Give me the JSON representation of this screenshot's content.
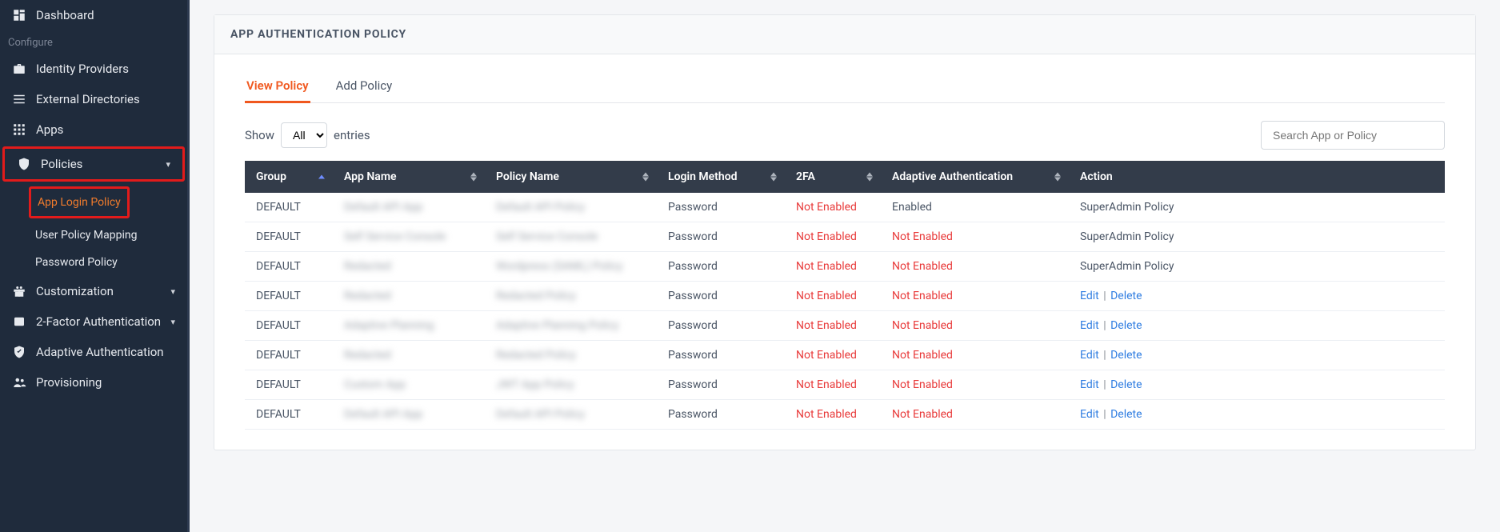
{
  "sidebar": {
    "dashboard": "Dashboard",
    "configure_label": "Configure",
    "identity_providers": "Identity Providers",
    "external_directories": "External Directories",
    "apps": "Apps",
    "policies": "Policies",
    "policies_children": {
      "app_login": "App Login Policy",
      "user_mapping": "User Policy Mapping",
      "password_policy": "Password Policy"
    },
    "customization": "Customization",
    "two_factor": "2-Factor Authentication",
    "adaptive_auth": "Adaptive Authentication",
    "provisioning": "Provisioning"
  },
  "page": {
    "title": "APP AUTHENTICATION POLICY"
  },
  "tabs": {
    "view": "View Policy",
    "add": "Add Policy"
  },
  "table_controls": {
    "show_label": "Show",
    "entries_label": "entries",
    "select_value": "All",
    "search_placeholder": "Search App or Policy"
  },
  "columns": {
    "group": "Group",
    "app_name": "App Name",
    "policy_name": "Policy Name",
    "login_method": "Login Method",
    "twofa": "2FA",
    "adaptive": "Adaptive Authentication",
    "action": "Action"
  },
  "rows": [
    {
      "group": "DEFAULT",
      "app": "Default API App",
      "policy": "Default API Policy",
      "login": "Password",
      "twofa": "Not Enabled",
      "twofa_red": true,
      "adaptive": "Enabled",
      "adaptive_red": false,
      "action_text": "SuperAdmin Policy",
      "action_links": false
    },
    {
      "group": "DEFAULT",
      "app": "Self Service Console",
      "policy": "Self Service Console",
      "login": "Password",
      "twofa": "Not Enabled",
      "twofa_red": true,
      "adaptive": "Not Enabled",
      "adaptive_red": true,
      "action_text": "SuperAdmin Policy",
      "action_links": false
    },
    {
      "group": "DEFAULT",
      "app": "Redacted",
      "policy": "Wordpress (SAML) Policy",
      "login": "Password",
      "twofa": "Not Enabled",
      "twofa_red": true,
      "adaptive": "Not Enabled",
      "adaptive_red": true,
      "action_text": "SuperAdmin Policy",
      "action_links": false
    },
    {
      "group": "DEFAULT",
      "app": "Redacted",
      "policy": "Redacted Policy",
      "login": "Password",
      "twofa": "Not Enabled",
      "twofa_red": true,
      "adaptive": "Not Enabled",
      "adaptive_red": true,
      "action_text": "",
      "action_links": true
    },
    {
      "group": "DEFAULT",
      "app": "Adaptive Planning",
      "policy": "Adaptive Planning Policy",
      "login": "Password",
      "twofa": "Not Enabled",
      "twofa_red": true,
      "adaptive": "Not Enabled",
      "adaptive_red": true,
      "action_text": "",
      "action_links": true
    },
    {
      "group": "DEFAULT",
      "app": "Redacted",
      "policy": "Redacted Policy",
      "login": "Password",
      "twofa": "Not Enabled",
      "twofa_red": true,
      "adaptive": "Not Enabled",
      "adaptive_red": true,
      "action_text": "",
      "action_links": true
    },
    {
      "group": "DEFAULT",
      "app": "Custom App",
      "policy": "JWT App Policy",
      "login": "Password",
      "twofa": "Not Enabled",
      "twofa_red": true,
      "adaptive": "Not Enabled",
      "adaptive_red": true,
      "action_text": "",
      "action_links": true
    },
    {
      "group": "DEFAULT",
      "app": "Default API App",
      "policy": "Default API Policy",
      "login": "Password",
      "twofa": "Not Enabled",
      "twofa_red": true,
      "adaptive": "Not Enabled",
      "adaptive_red": true,
      "action_text": "",
      "action_links": true
    }
  ],
  "action_labels": {
    "edit": "Edit",
    "delete": "Delete"
  }
}
